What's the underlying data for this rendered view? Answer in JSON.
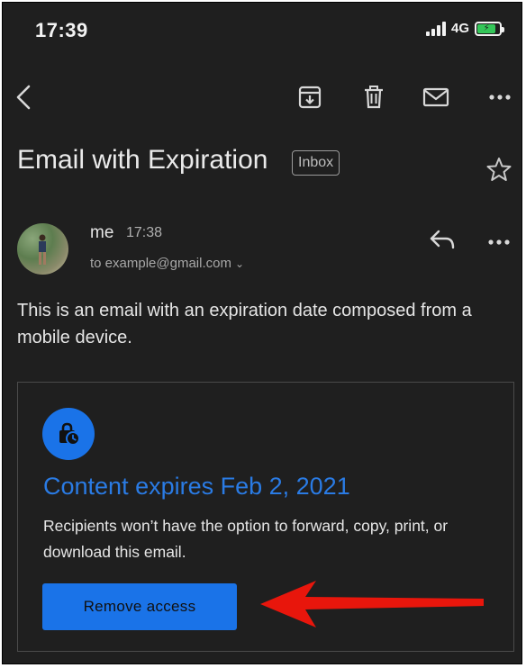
{
  "status_bar": {
    "time": "17:39",
    "network": "4G",
    "battery_level": 0.85
  },
  "toolbar": {
    "icons": [
      "back-arrow-icon",
      "archive-icon",
      "trash-icon",
      "mail-icon",
      "more-icon"
    ]
  },
  "email": {
    "subject": "Email with Expiration",
    "label_badge": "Inbox",
    "sender_name": "me",
    "sent_time": "17:38",
    "recipient_line": "to example@gmail.com",
    "body": "This is an email with an expiration date composed from a mobile device."
  },
  "expiration_card": {
    "title": "Content expires Feb 2, 2021",
    "description": "Recipients won’t have the option to forward, copy, print, or download this email.",
    "button_label": "Remove access"
  },
  "colors": {
    "background": "#1f1f1f",
    "accent_blue": "#1a73e8",
    "annotation_red": "#e8160c"
  }
}
